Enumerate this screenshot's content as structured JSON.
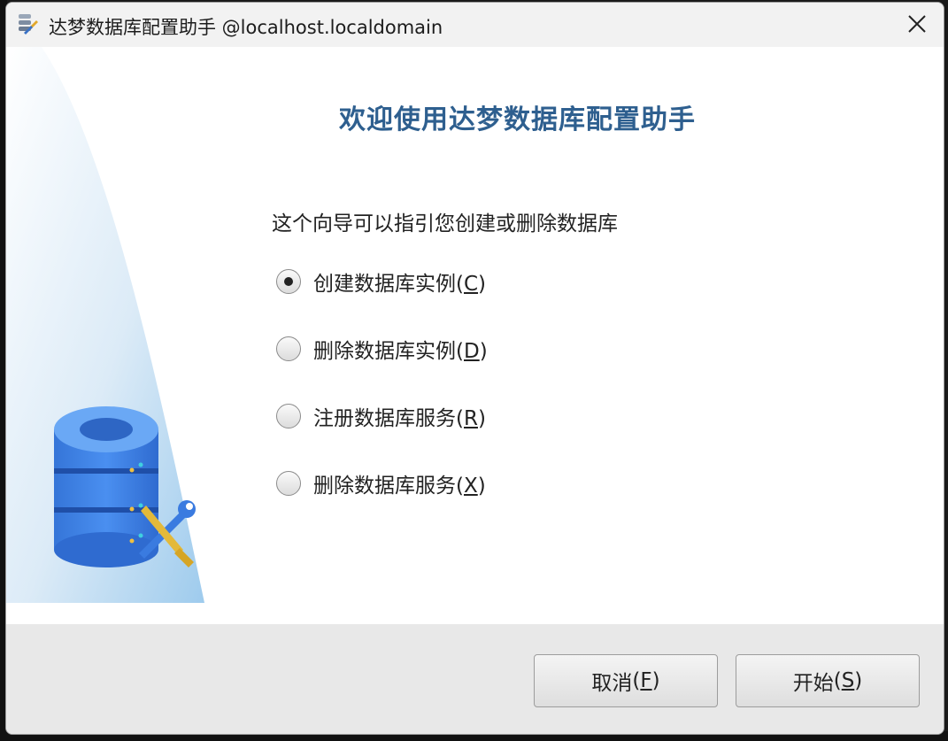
{
  "window": {
    "title": "达梦数据库配置助手 @localhost.localdomain",
    "close_symbol": "✕"
  },
  "main": {
    "heading": "欢迎使用达梦数据库配置助手",
    "intro": "这个向导可以指引您创建或删除数据库",
    "options": [
      {
        "label": "创建数据库实例",
        "mnemonic": "C",
        "selected": true
      },
      {
        "label": "删除数据库实例",
        "mnemonic": "D",
        "selected": false
      },
      {
        "label": "注册数据库服务",
        "mnemonic": "R",
        "selected": false
      },
      {
        "label": "删除数据库服务",
        "mnemonic": "X",
        "selected": false
      }
    ]
  },
  "footer": {
    "cancel": {
      "label": "取消",
      "mnemonic": "F"
    },
    "start": {
      "label": "开始",
      "mnemonic": "S"
    }
  },
  "colors": {
    "heading": "#2e5f8f",
    "db_icon": "#3c82de",
    "side_gradient": "#a9d0ee"
  },
  "icons": {
    "app": "database-config-icon",
    "illustration": "database-wrench-icon",
    "close": "close-icon"
  }
}
